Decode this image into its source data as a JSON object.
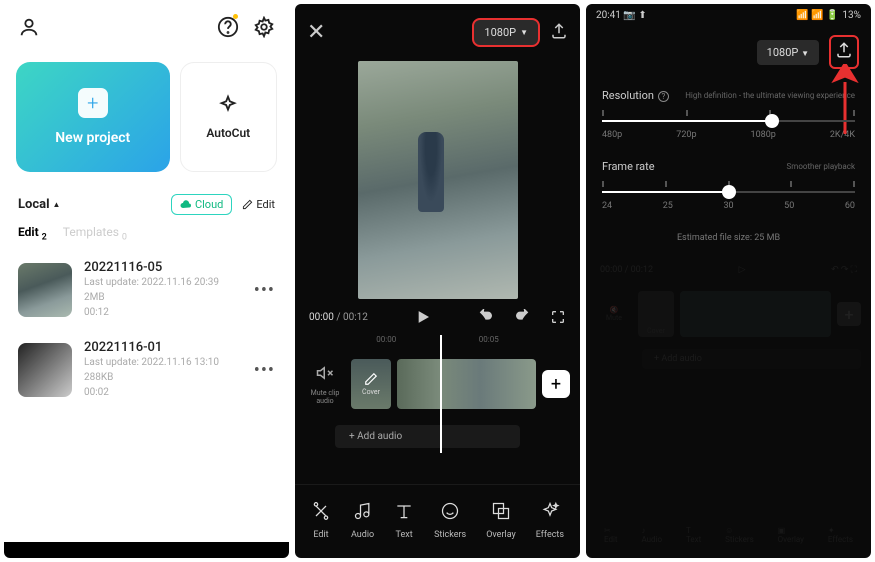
{
  "phone1": {
    "new_project": "New project",
    "autocut": "AutoCut",
    "local": "Local",
    "cloud": "Cloud",
    "edit": "Edit",
    "tab_edit": "Edit",
    "tab_edit_count": "2",
    "tab_templates": "Templates",
    "tab_templates_count": "0",
    "projects": [
      {
        "title": "20221116-05",
        "updated": "Last update: 2022.11.16 20:39",
        "size": "2MB",
        "dur": "00:12"
      },
      {
        "title": "20221116-01",
        "updated": "Last update: 2022.11.16 13:10",
        "size": "288KB",
        "dur": "00:02"
      }
    ]
  },
  "phone2": {
    "res_label": "1080P",
    "time_cur": "00:00",
    "time_total": "00:12",
    "ruler": [
      "00:00",
      "00:05"
    ],
    "mute_clip": "Mute clip audio",
    "cover": "Cover",
    "add_audio": "+ Add audio",
    "tools": [
      "Edit",
      "Audio",
      "Text",
      "Stickers",
      "Overlay",
      "Effects"
    ]
  },
  "phone3": {
    "status_time": "20:41",
    "battery": "13%",
    "res_label": "1080P",
    "resolution_title": "Resolution",
    "resolution_hint": "High definition - the ultimate viewing experience",
    "res_labels": [
      "480p",
      "720p",
      "1080p",
      "2K/4K"
    ],
    "framerate_title": "Frame rate",
    "framerate_hint": "Smoother playback",
    "fr_labels": [
      "24",
      "25",
      "30",
      "50",
      "60"
    ],
    "est_size": "Estimated file size: 25 MB"
  }
}
